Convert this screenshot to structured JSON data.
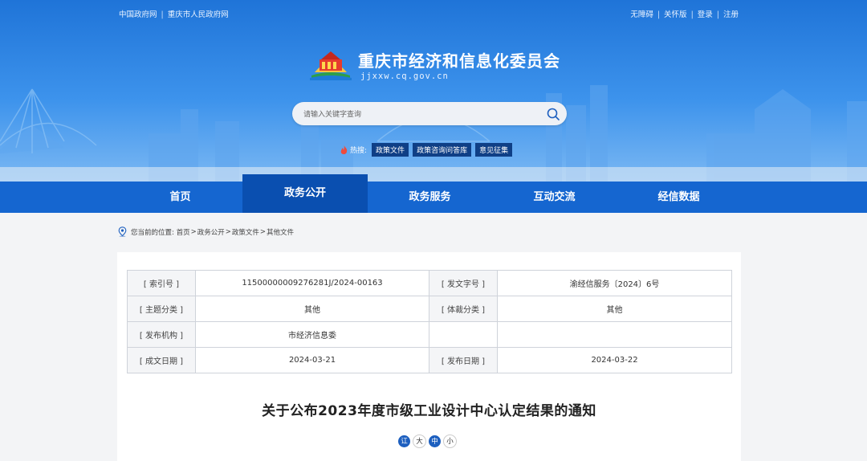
{
  "header": {
    "top_left": [
      "中国政府网",
      "重庆市人民政府网"
    ],
    "top_right": [
      "无障碍",
      "关怀版",
      "登录",
      "注册"
    ],
    "site_title": "重庆市经济和信息化委员会",
    "site_domain": "jjxxw.cq.gov.cn",
    "search_placeholder": "请输入关键字查询",
    "hot_label": "热搜:",
    "hot_tags": [
      "政策文件",
      "政策咨询问答库",
      "意见征集"
    ]
  },
  "nav": {
    "items": [
      "首页",
      "政务公开",
      "政务服务",
      "互动交流",
      "经信数据"
    ],
    "active": "政务公开"
  },
  "breadcrumb": {
    "prefix": "您当前的位置:",
    "items": [
      "首页",
      "政务公开",
      "政策文件",
      "其他文件"
    ],
    "separator": ">"
  },
  "doc_meta": {
    "rows": [
      [
        {
          "k": "[ 索引号 ]",
          "v": "11500000009276281J/2024-00163"
        },
        {
          "k": "[ 发文字号 ]",
          "v": "渝经信服务〔2024〕6号"
        }
      ],
      [
        {
          "k": "[ 主题分类 ]",
          "v": "其他"
        },
        {
          "k": "[ 体裁分类 ]",
          "v": "其他"
        }
      ],
      [
        {
          "k": "[ 发布机构 ]",
          "v": "市经济信息委"
        },
        {
          "k": "",
          "v": ""
        }
      ],
      [
        {
          "k": "[ 成文日期 ]",
          "v": "2024-03-21"
        },
        {
          "k": "[ 发布日期 ]",
          "v": "2024-03-22"
        }
      ]
    ]
  },
  "doc_title": "关于公布2023年度市级工业设计中心认定结果的通知",
  "font_size": {
    "buttons": [
      "讧",
      "大",
      "中",
      "小"
    ]
  },
  "colors": {
    "banner": "#2f86e6",
    "nav": "#1566d0",
    "nav_active": "#0a4fb0",
    "hot_tag": "#0f3f86"
  }
}
